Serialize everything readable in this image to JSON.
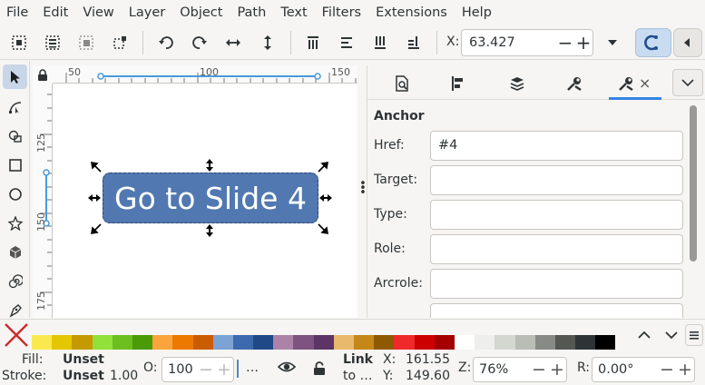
{
  "menu": [
    "File",
    "Edit",
    "View",
    "Layer",
    "Object",
    "Path",
    "Text",
    "Filters",
    "Extensions",
    "Help"
  ],
  "toolbar": {
    "x_label": "X:",
    "x_value": "63.427",
    "minus": "−",
    "plus": "+"
  },
  "ruler": {
    "h_ticks": [
      "50",
      "100",
      "150"
    ],
    "v_ticks": [
      "125",
      "150",
      "175"
    ]
  },
  "canvas": {
    "button_text": "Go to Slide 4",
    "button_color": "#5178b0"
  },
  "dock": {
    "section_title": "Anchor",
    "close_glyph": "×",
    "fields": [
      {
        "label": "Href:",
        "value": "#4"
      },
      {
        "label": "Target:",
        "value": ""
      },
      {
        "label": "Type:",
        "value": ""
      },
      {
        "label": "Role:",
        "value": ""
      },
      {
        "label": "Arcrole:",
        "value": ""
      }
    ]
  },
  "palette": {
    "colors": [
      "#f9e94f",
      "#e5c700",
      "#c49a00",
      "#92e03a",
      "#6bbf1f",
      "#4b9a08",
      "#f9a43c",
      "#ec7a00",
      "#cb5c00",
      "#7ca3d3",
      "#3d6aaf",
      "#204a87",
      "#ad82a8",
      "#7f5380",
      "#5c3566",
      "#e9b96e",
      "#c4881a",
      "#8f5902",
      "#ef2929",
      "#cc0000",
      "#a40000",
      "#ffffff",
      "#eeeeec",
      "#d3d7cf",
      "#babdb6",
      "#888a85",
      "#555753",
      "#2e3436",
      "#000000"
    ]
  },
  "status": {
    "fill_label": "Fill:",
    "fill_value": "Unset",
    "stroke_label": "Stroke:",
    "stroke_value": "Unset",
    "stroke_width": "1.00",
    "opacity_label": "O:",
    "opacity_value": "100",
    "layer_dots": "…",
    "link_line1": "Link",
    "link_line2": "to …",
    "x_label": "X:",
    "x_value": "161.55",
    "y_label": "Y:",
    "y_value": "149.60",
    "zoom_label": "Z:",
    "zoom_value": "76%",
    "rotate_label": "R:",
    "rotate_value": "0.00°"
  }
}
